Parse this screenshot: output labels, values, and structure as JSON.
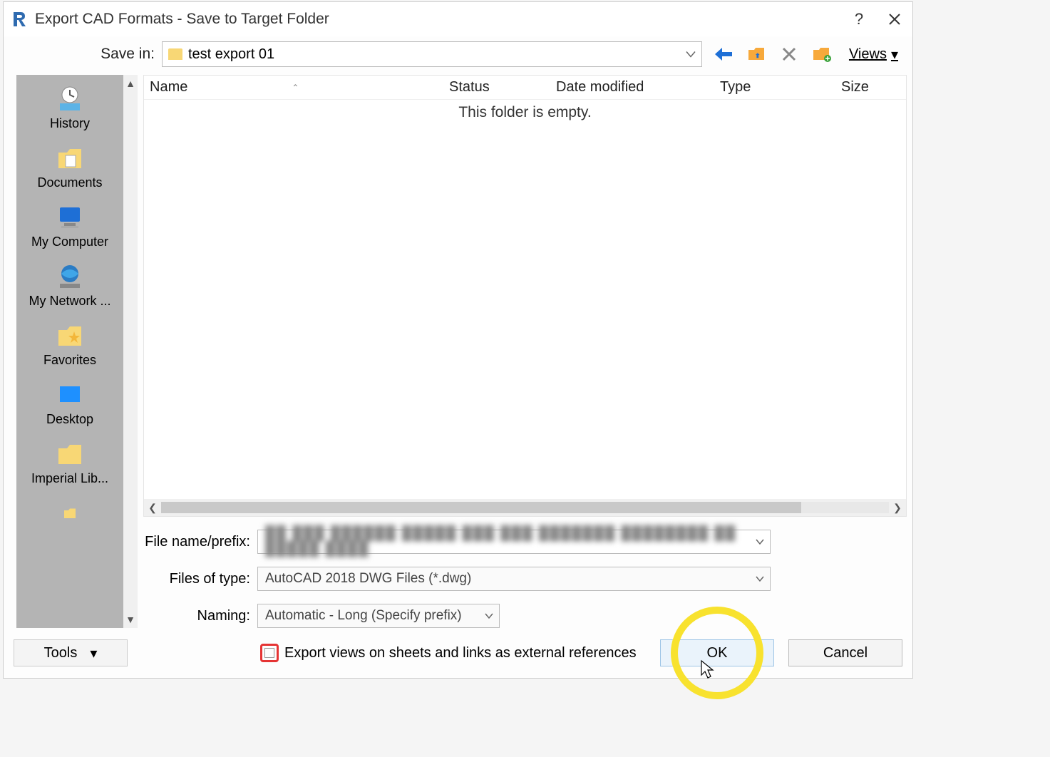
{
  "titlebar": {
    "title": "Export CAD Formats - Save to Target Folder"
  },
  "savein": {
    "label": "Save in:",
    "folder": "test export 01",
    "views_label": "Views"
  },
  "sidebar": {
    "items": [
      {
        "label": "History"
      },
      {
        "label": "Documents"
      },
      {
        "label": "My Computer"
      },
      {
        "label": "My Network ..."
      },
      {
        "label": "Favorites"
      },
      {
        "label": "Desktop"
      },
      {
        "label": "Imperial Lib..."
      }
    ]
  },
  "columns": {
    "name": "Name",
    "status": "Status",
    "date": "Date modified",
    "type": "Type",
    "size": "Size"
  },
  "list": {
    "empty_message": "This folder is empty."
  },
  "form": {
    "filename_label": "File name/prefix:",
    "filename_value": "",
    "filetype_label": "Files of type:",
    "filetype_value": "AutoCAD 2018 DWG Files (*.dwg)",
    "naming_label": "Naming:",
    "naming_value": "Automatic - Long (Specify prefix)"
  },
  "bottom": {
    "tools": "Tools",
    "checkbox_label": "Export views on sheets and links as external references",
    "ok": "OK",
    "cancel": "Cancel"
  }
}
